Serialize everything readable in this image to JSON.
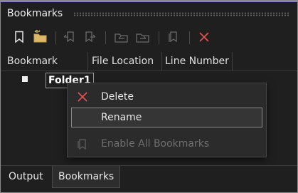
{
  "window": {
    "title": "Bookmarks",
    "accent_color": "#8b7cd8"
  },
  "toolbar": {
    "buttons": [
      {
        "icon": "bookmark-toggle-icon",
        "enabled": true
      },
      {
        "icon": "new-folder-icon",
        "enabled": true
      },
      {
        "icon": "previous-bookmark-icon",
        "enabled": false
      },
      {
        "icon": "next-bookmark-icon",
        "enabled": false
      },
      {
        "icon": "previous-bookmark-in-folder-icon",
        "enabled": false
      },
      {
        "icon": "next-bookmark-in-folder-icon",
        "enabled": false
      },
      {
        "icon": "disable-all-bookmarks-icon",
        "enabled": false
      },
      {
        "icon": "delete-icon",
        "enabled": true,
        "color": "#e05252"
      }
    ]
  },
  "columns": [
    "Bookmark",
    "File Location",
    "Line Number"
  ],
  "rows": [
    {
      "checked": false,
      "label": "Folder1",
      "editing": true
    }
  ],
  "context_menu": {
    "items": [
      {
        "label": "Delete",
        "icon": "delete-x-icon",
        "enabled": true,
        "icon_color": "#e05252"
      },
      {
        "label": "Rename",
        "enabled": true,
        "selected": true
      },
      {
        "label": "Enable All Bookmarks",
        "icon": "enable-bookmarks-icon",
        "enabled": false
      }
    ]
  },
  "tabs": [
    {
      "label": "Output",
      "active": false
    },
    {
      "label": "Bookmarks",
      "active": true
    }
  ]
}
